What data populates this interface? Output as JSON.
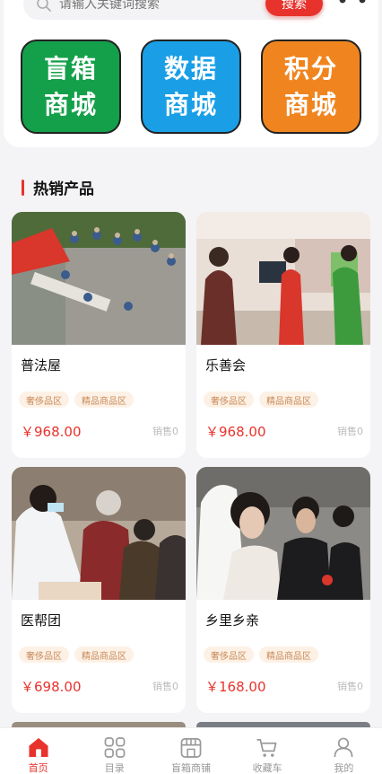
{
  "search": {
    "placeholder": "请输入关键词搜索",
    "button_label": "搜索"
  },
  "quick_tiles": [
    {
      "line1": "盲箱",
      "line2": "商城",
      "color": "#14a04a"
    },
    {
      "line1": "数据",
      "line2": "商城",
      "color": "#1a9fe6"
    },
    {
      "line1": "积分",
      "line2": "商城",
      "color": "#f0851f"
    }
  ],
  "section": {
    "title": "热销产品"
  },
  "products": [
    {
      "name": "普法屋",
      "tags": [
        "奢侈品区",
        "精品商品区"
      ],
      "price": "￥968.00",
      "sales": "销售0"
    },
    {
      "name": "乐善会",
      "tags": [
        "奢侈品区",
        "精品商品区"
      ],
      "price": "￥968.00",
      "sales": "销售0"
    },
    {
      "name": "医帮团",
      "tags": [
        "奢侈品区",
        "精品商品区"
      ],
      "price": "￥698.00",
      "sales": "销售0"
    },
    {
      "name": "乡里乡亲",
      "tags": [
        "奢侈品区",
        "精品商品区"
      ],
      "price": "￥168.00",
      "sales": "销售0"
    }
  ],
  "bottom_nav": [
    {
      "label": "首页",
      "icon": "home-icon",
      "active": true
    },
    {
      "label": "目录",
      "icon": "grid-icon",
      "active": false
    },
    {
      "label": "盲箱商铺",
      "icon": "store-icon",
      "active": false
    },
    {
      "label": "收藏车",
      "icon": "cart-icon",
      "active": false
    },
    {
      "label": "我的",
      "icon": "user-icon",
      "active": false
    }
  ],
  "colors": {
    "accent": "#e8332c",
    "tag_bg": "#fdf1e6",
    "tag_text": "#c98a58"
  }
}
